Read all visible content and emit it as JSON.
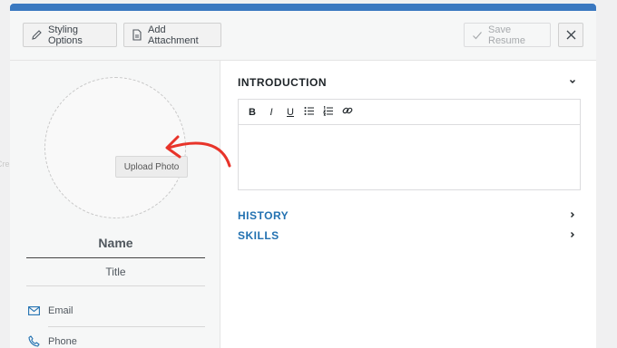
{
  "background_hint": "Cre",
  "toolbar": {
    "styling_label": "Styling Options",
    "attach_label": "Add Attachment",
    "save_label": "Save Resume",
    "close_icon": "close-icon"
  },
  "sidebar": {
    "upload_label": "Upload Photo",
    "name_label": "Name",
    "title_label": "Title",
    "email_label": "Email",
    "phone_label": "Phone"
  },
  "main": {
    "intro_label": "INTRODUCTION",
    "history_label": "HISTORY",
    "skills_label": "SKILLS",
    "editor_tools": [
      "B",
      "I",
      "U"
    ]
  },
  "colors": {
    "accent": "#2271b1",
    "top_bar": "#3a78c0",
    "annotation_arrow": "#e8342a"
  }
}
